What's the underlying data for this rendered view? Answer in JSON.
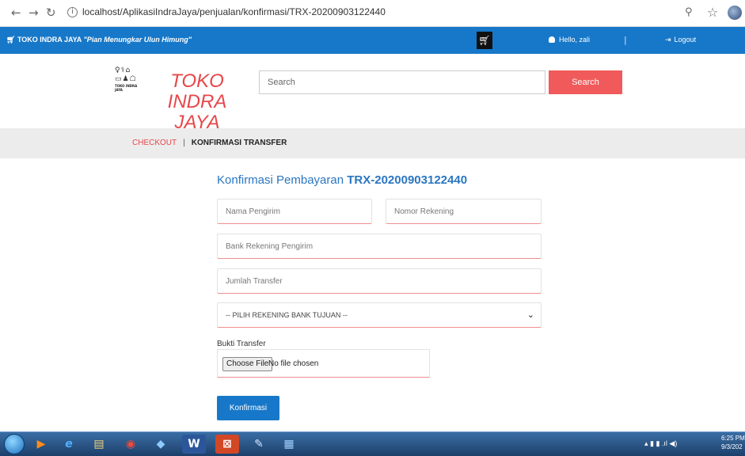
{
  "browser": {
    "back_icon": "arrow-left-icon",
    "forward_icon": "arrow-right-icon",
    "reload_icon": "reload-icon",
    "url": "localhost/AplikasiIndraJaya/penjualan/konfirmasi/TRX-20200903122440"
  },
  "topbar": {
    "brand_name": "TOKO INDRA JAYA",
    "brand_tagline": "\"Pian Menungkar Ulun Himung\"",
    "greeting": "Hello, zali",
    "separator": "|",
    "logout_label": "Logout",
    "color": "#1778c9"
  },
  "header": {
    "logo_small_text": "TOKO INDRA JAYA",
    "logo_title": "TOKO INDRA JAYA",
    "search_placeholder": "Search",
    "search_button": "Search",
    "accent": "#e7474a"
  },
  "breadcrumb": {
    "step1": "CHECKOUT",
    "separator": "|",
    "step2": "KONFIRMASI TRANSFER"
  },
  "form": {
    "title_prefix": "Konfirmasi Pembayaran",
    "transaction_id": "TRX-20200903122440",
    "nama_pengirim_placeholder": "Nama Pengirim",
    "nomor_rekening_placeholder": "Nomor Rekening",
    "bank_pengirim_placeholder": "Bank Rekening Pengirim",
    "jumlah_transfer_placeholder": "Jumlah Transfer",
    "bank_tujuan_selected": "-- PILIH REKENING BANK TUJUAN --",
    "bukti_label": "Bukti Transfer",
    "file_button": "Choose File",
    "file_status": "No file chosen",
    "submit_label": "Konfirmasi"
  },
  "taskbar": {
    "time": "6:25 PM",
    "date": "9/3/202"
  }
}
